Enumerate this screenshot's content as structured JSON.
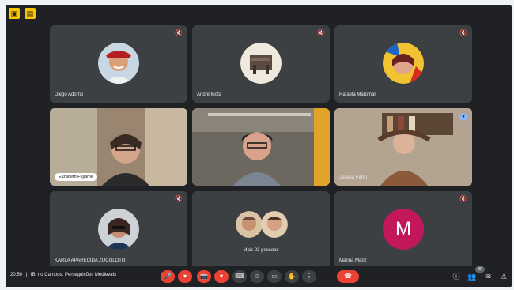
{
  "participants": [
    {
      "name": "Diego Adorno"
    },
    {
      "name": "André Mota"
    },
    {
      "name": "Rafaela Maromar"
    },
    {
      "name": "Elizabeth Fujiame"
    },
    {
      "name": ""
    },
    {
      "name": "Juliana Ferro"
    },
    {
      "name": "KARLA APARECIDA ZUCOLOTO"
    },
    {
      "name": "Mais 23 pessoas"
    },
    {
      "name": "Marina Manz",
      "initial": "M"
    }
  ],
  "bar": {
    "time": "20:50",
    "separator": "|",
    "meeting_title": "IBI no Campus: Perseguições Medievais",
    "people_count": "30"
  },
  "colors": {
    "background": "#202124",
    "tile": "#3c4043",
    "accent": "#8ab4f8",
    "leave": "#ea4335",
    "avatar_m": "#c2185b"
  },
  "icons": {
    "mic": "mic-off-icon",
    "leave": "call-end-icon"
  }
}
